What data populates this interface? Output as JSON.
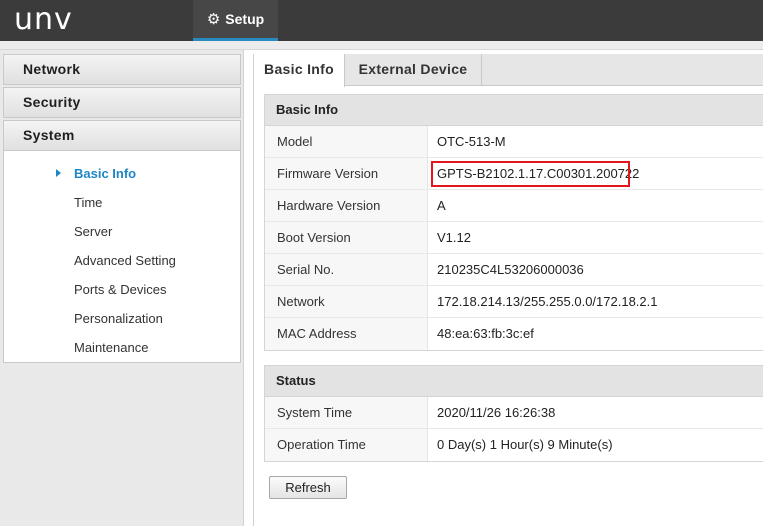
{
  "header": {
    "logo": "unv",
    "setup_tab": {
      "label": "Setup",
      "icon": "gear-icon"
    }
  },
  "sidebar": {
    "sections": [
      {
        "label": "Network"
      },
      {
        "label": "Security"
      },
      {
        "label": "System"
      }
    ],
    "system_items": [
      {
        "label": "Basic Info",
        "active": true
      },
      {
        "label": "Time"
      },
      {
        "label": "Server"
      },
      {
        "label": "Advanced Setting"
      },
      {
        "label": "Ports & Devices"
      },
      {
        "label": "Personalization"
      },
      {
        "label": "Maintenance"
      }
    ]
  },
  "tabs": [
    {
      "label": "Basic Info",
      "active": true
    },
    {
      "label": "External Device"
    }
  ],
  "basic_info": {
    "title": "Basic Info",
    "rows": [
      {
        "label": "Model",
        "value": "OTC-513-M"
      },
      {
        "label": "Firmware Version",
        "value": "GPTS-B2102.1.17.C00301.200722",
        "highlighted": true
      },
      {
        "label": "Hardware Version",
        "value": "A"
      },
      {
        "label": "Boot Version",
        "value": "V1.12"
      },
      {
        "label": "Serial No.",
        "value": "210235C4L53206000036"
      },
      {
        "label": "Network",
        "value": "172.18.214.13/255.255.0.0/172.18.2.1"
      },
      {
        "label": "MAC Address",
        "value": "48:ea:63:fb:3c:ef"
      }
    ]
  },
  "status": {
    "title": "Status",
    "rows": [
      {
        "label": "System Time",
        "value": "2020/11/26 16:26:38"
      },
      {
        "label": "Operation Time",
        "value": "0 Day(s) 1 Hour(s) 9 Minute(s)"
      }
    ]
  },
  "buttons": {
    "refresh": "Refresh"
  },
  "colors": {
    "topbar": "#3b3b3b",
    "accent": "#1f86c6",
    "highlight_box": "#e3161c"
  }
}
